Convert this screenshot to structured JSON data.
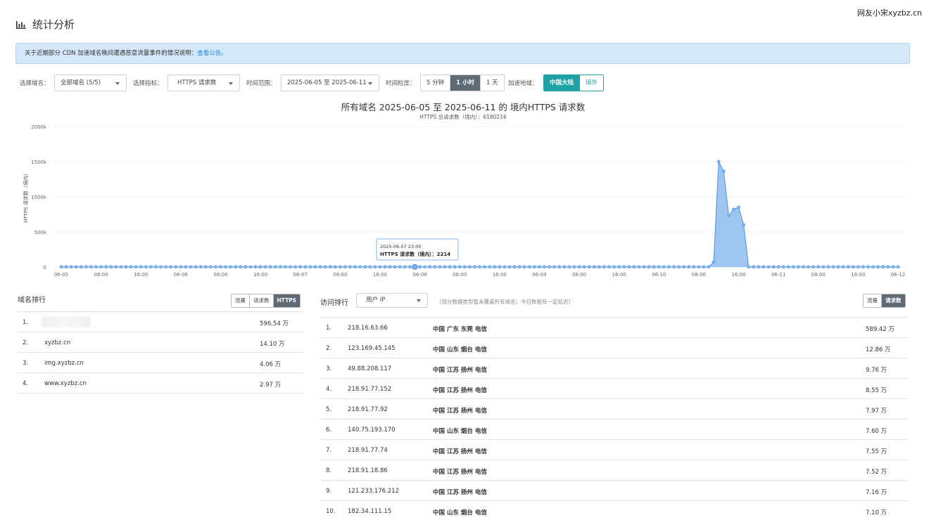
{
  "watermark": "网友小宋xyzbz.cn",
  "page": {
    "title": "统计分析"
  },
  "notice": {
    "text": "关于近期部分 CDN 加速域名晚间遭遇恶意流量事件的情况说明：",
    "link": "查看公告。"
  },
  "filters": {
    "domain_label": "选择域名：",
    "domain_value": "全部域名 (5/5)",
    "metric_label": "选择指标：",
    "metric_value": "HTTPS 请求数",
    "range_label": "时间范围：",
    "range_value": "2025-06-05 至 2025-06-11",
    "granularity_label": "时间粒度：",
    "granularity_options": [
      "5 分钟",
      "1 小时",
      "1 天"
    ],
    "granularity_selected": "1 小时",
    "region_label": "加速地域：",
    "region_options": [
      "中国大陆",
      "境外"
    ],
    "region_selected": "中国大陆"
  },
  "chart_data": {
    "type": "area",
    "title": "所有域名 2025-06-05 至 2025-06-11 的 境内HTTPS 请求数",
    "subtitle": "HTTPS 总请求数（境内）：6180216",
    "ylabel": "HTTPS 请求数（境内）",
    "ylim": [
      0,
      2000000
    ],
    "y_ticks": [
      "0",
      "500k",
      "1000k",
      "1500k",
      "2000k"
    ],
    "x_tick_labels": [
      "06-05",
      "08:00",
      "16:00",
      "06-06",
      "08:00",
      "16:00",
      "06-07",
      "08:00",
      "16:00",
      "06-08",
      "08:00",
      "16:00",
      "06-09",
      "08:00",
      "16:00",
      "06-10",
      "08:00",
      "16:00",
      "06-11",
      "08:00",
      "16:00",
      "06-12"
    ],
    "x_start": "2025-06-05 00:00",
    "hours": 168,
    "baseline_value": 2200,
    "spike_points": [
      [
        131,
        70000
      ],
      [
        132,
        1500000
      ],
      [
        133,
        1360000
      ],
      [
        134,
        730000
      ],
      [
        135,
        820000
      ],
      [
        136,
        850000
      ],
      [
        137,
        600000
      ]
    ],
    "grid": true,
    "color": "#7fb3ec",
    "tooltip": {
      "time": "2025-06-07 23:00",
      "label": "HTTPS 请求数（境内）：2214",
      "hour_index": 71,
      "value": 2214
    }
  },
  "domain_rank": {
    "title": "域名排行",
    "toggle": [
      "流量",
      "请求数",
      "HTTPS"
    ],
    "toggle_selected": "HTTPS",
    "rows": [
      {
        "rank": "1.",
        "domain": "",
        "value": "596.54 万"
      },
      {
        "rank": "2.",
        "domain": "xyzbz.cn",
        "value": "14.10 万"
      },
      {
        "rank": "3.",
        "domain": "img.xyzbz.cn",
        "value": "4.06 万"
      },
      {
        "rank": "4.",
        "domain": "www.xyzbz.cn",
        "value": "2.97 万"
      }
    ]
  },
  "visit_rank": {
    "title": "访问排行",
    "select_value": "用户 IP",
    "hint": "（部分数据类型暂未覆盖所有域名；今日数据有一定延迟）",
    "toggle": [
      "流量",
      "请求数"
    ],
    "toggle_selected": "请求数",
    "rows": [
      {
        "rank": "1.",
        "ip": "218.16.63.66",
        "location": "中国 广东 东莞 电信",
        "value": "589.42 万"
      },
      {
        "rank": "2.",
        "ip": "123.169.45.145",
        "location": "中国 山东 烟台 电信",
        "value": "12.86 万"
      },
      {
        "rank": "3.",
        "ip": "49.88.208.117",
        "location": "中国 江苏 扬州 电信",
        "value": "9.76 万"
      },
      {
        "rank": "4.",
        "ip": "218.91.77.152",
        "location": "中国 江苏 扬州 电信",
        "value": "8.55 万"
      },
      {
        "rank": "5.",
        "ip": "218.91.77.92",
        "location": "中国 江苏 扬州 电信",
        "value": "7.97 万"
      },
      {
        "rank": "6.",
        "ip": "140.75.193.170",
        "location": "中国 山东 烟台 电信",
        "value": "7.60 万"
      },
      {
        "rank": "7.",
        "ip": "218.91.77.74",
        "location": "中国 江苏 扬州 电信",
        "value": "7.55 万"
      },
      {
        "rank": "8.",
        "ip": "218.91.18.86",
        "location": "中国 江苏 扬州 电信",
        "value": "7.52 万"
      },
      {
        "rank": "9.",
        "ip": "121.233.176.212",
        "location": "中国 江苏 扬州 电信",
        "value": "7.16 万"
      },
      {
        "rank": "10.",
        "ip": "182.34.111.15",
        "location": "中国 山东 烟台 电信",
        "value": "7.10 万"
      }
    ]
  }
}
